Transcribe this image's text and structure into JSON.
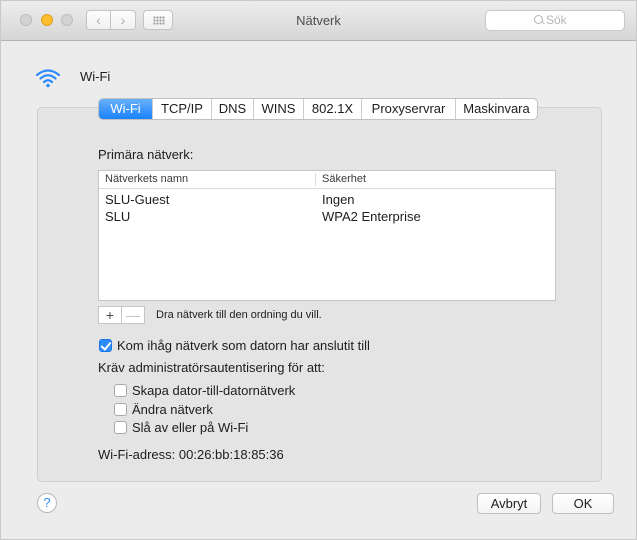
{
  "window": {
    "title": "Nätverk",
    "search_placeholder": "Sök"
  },
  "header": {
    "title": "Wi-Fi",
    "icon": "wifi-icon"
  },
  "tabs": [
    {
      "label": "Wi-Fi",
      "selected": true
    },
    {
      "label": "TCP/IP",
      "selected": false
    },
    {
      "label": "DNS",
      "selected": false
    },
    {
      "label": "WINS",
      "selected": false
    },
    {
      "label": "802.1X",
      "selected": false
    },
    {
      "label": "Proxyservrar",
      "selected": false
    },
    {
      "label": "Maskinvara",
      "selected": false
    }
  ],
  "preferred": {
    "label": "Primära nätverk:",
    "columns": {
      "name": "Nätverkets namn",
      "security": "Säkerhet"
    },
    "rows": [
      {
        "name": "SLU-Guest",
        "security": "Ingen"
      },
      {
        "name": "SLU",
        "security": "WPA2 Enterprise"
      }
    ],
    "add_label": "+",
    "remove_label": "—",
    "hint": "Dra nätverk till den ordning du vill."
  },
  "options": {
    "remember": {
      "label": "Kom ihåg nätverk som datorn har anslutit till",
      "checked": true
    },
    "admin_label": "Kräv administratörsautentisering för att:",
    "admin_items": [
      {
        "label": "Skapa dator-till-datornätverk",
        "checked": false
      },
      {
        "label": "Ändra nätverk",
        "checked": false
      },
      {
        "label": "Slå av eller på Wi-Fi",
        "checked": false
      }
    ]
  },
  "address": {
    "label": "Wi-Fi-adress:",
    "value": "00:26:bb:18:85:36"
  },
  "footer": {
    "help_label": "?",
    "cancel_label": "Avbryt",
    "ok_label": "OK"
  },
  "colors": {
    "accent": "#1a82fb",
    "window_bg": "#ececec"
  }
}
